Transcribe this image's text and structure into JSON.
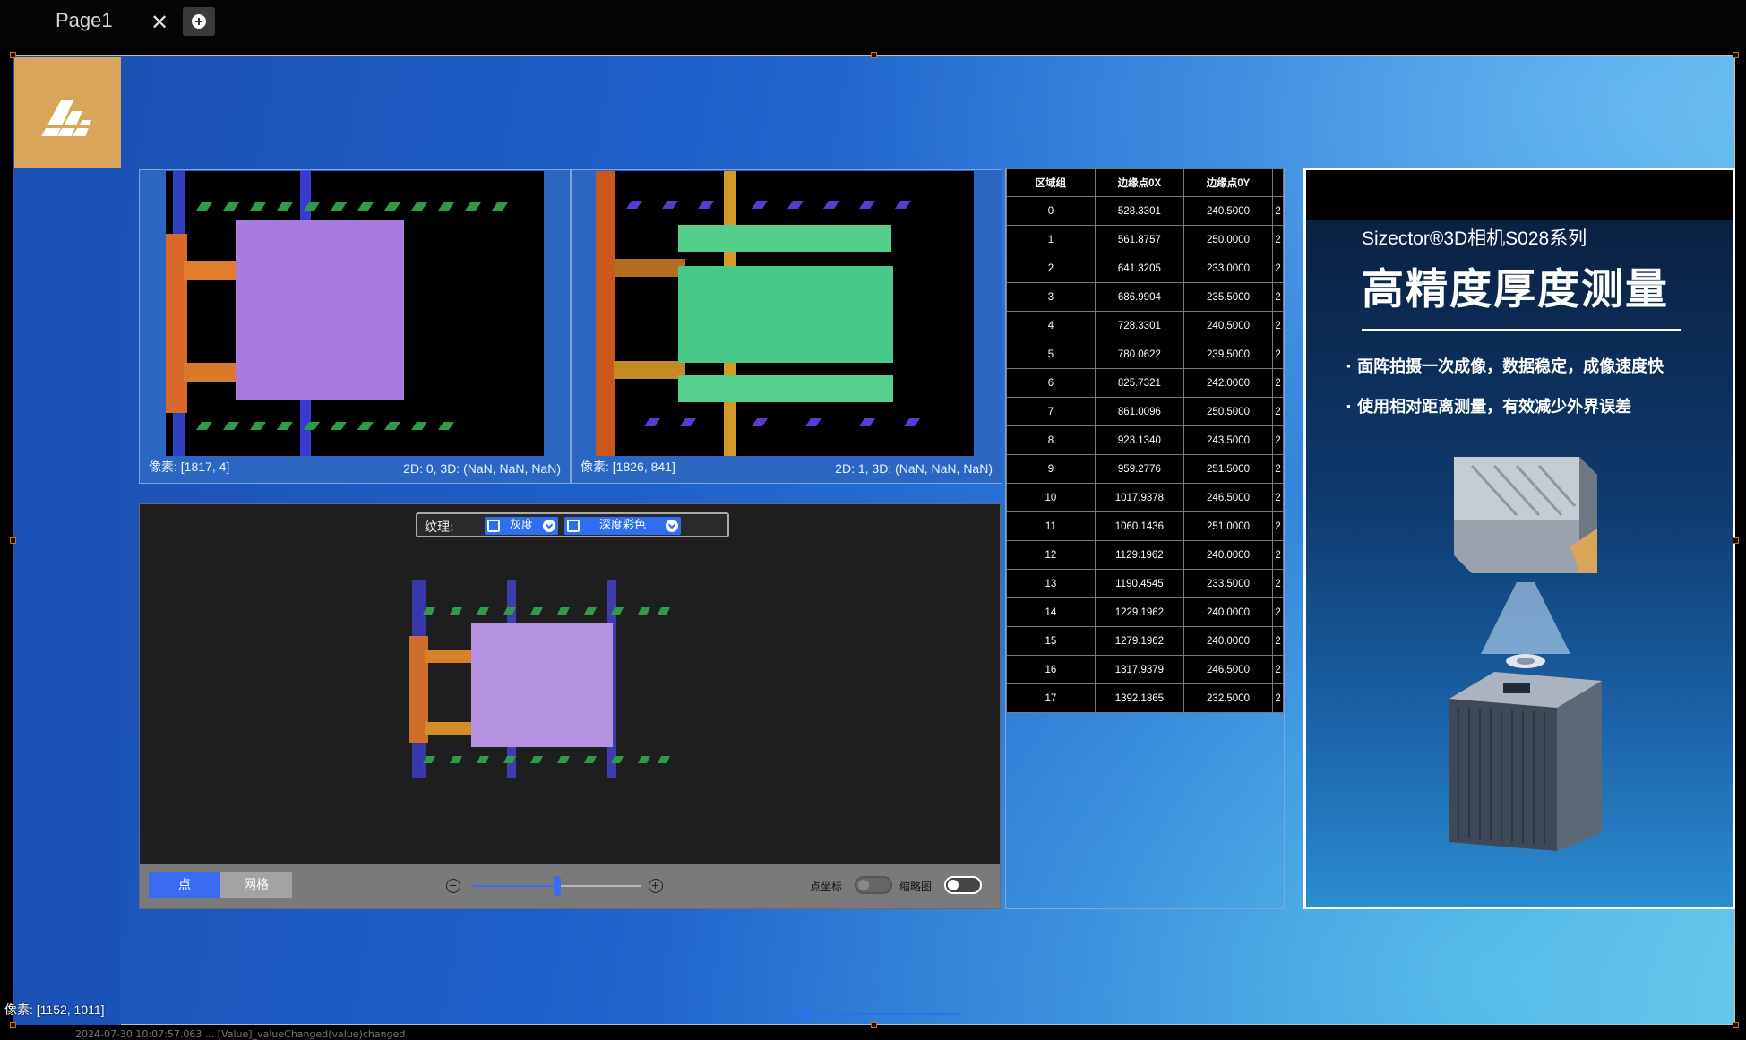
{
  "tab": {
    "title": "Page1",
    "close_glyph": "✕"
  },
  "panels": {
    "left": {
      "pixel": "像素: [1817, 4]",
      "dims": "2D: 0, 3D: (NaN, NaN, NaN)"
    },
    "right": {
      "pixel": "像素: [1826, 841]",
      "dims": "2D: 1, 3D: (NaN, NaN, NaN)"
    }
  },
  "viewer": {
    "texture_label": "纹理:",
    "texture_gray": "灰度",
    "texture_depth": "深度彩色",
    "btn_point": "点",
    "btn_mesh": "网格",
    "zoom_level": 0.5,
    "toggle_coord_label": "点坐标",
    "toggle_coord_on": false,
    "toggle_thumb_label": "缩略图",
    "toggle_thumb_on": true
  },
  "table": {
    "headers": [
      "区域组",
      "边缘点0X",
      "边缘点0Y"
    ],
    "rows": [
      [
        "0",
        "528.3301",
        "240.5000"
      ],
      [
        "1",
        "561.8757",
        "250.0000"
      ],
      [
        "2",
        "641.3205",
        "233.0000"
      ],
      [
        "3",
        "686.9904",
        "235.5000"
      ],
      [
        "4",
        "728.3301",
        "240.5000"
      ],
      [
        "5",
        "780.0622",
        "239.5000"
      ],
      [
        "6",
        "825.7321",
        "242.0000"
      ],
      [
        "7",
        "861.0096",
        "250.5000"
      ],
      [
        "8",
        "923.1340",
        "243.5000"
      ],
      [
        "9",
        "959.2776",
        "251.5000"
      ],
      [
        "10",
        "1017.9378",
        "246.5000"
      ],
      [
        "11",
        "1060.1436",
        "251.0000"
      ],
      [
        "12",
        "1129.1962",
        "240.0000"
      ],
      [
        "13",
        "1190.4545",
        "233.5000"
      ],
      [
        "14",
        "1229.1962",
        "240.0000"
      ],
      [
        "15",
        "1279.1962",
        "240.0000"
      ],
      [
        "16",
        "1317.9379",
        "246.5000"
      ],
      [
        "17",
        "1392.1865",
        "232.5000"
      ]
    ],
    "partial_col": "2"
  },
  "ad": {
    "subtitle": "Sizector®3D相机S028系列",
    "title": "高精度厚度测量",
    "bullet1": "· 面阵拍摄一次成像，数据稳定，成像速度快",
    "bullet2": "· 使用相对距离测量，有效减少外界误差"
  },
  "status": {
    "pixel": "像素: [1152, 1011]",
    "log": "2024-07-30 10:07:57.063 ... [Value]_valueChanged(value)changed"
  },
  "colors": {
    "accent": "#2e6ff2",
    "logo_bg": "#d9a659",
    "canvas_blue": "#1d5fc9"
  }
}
